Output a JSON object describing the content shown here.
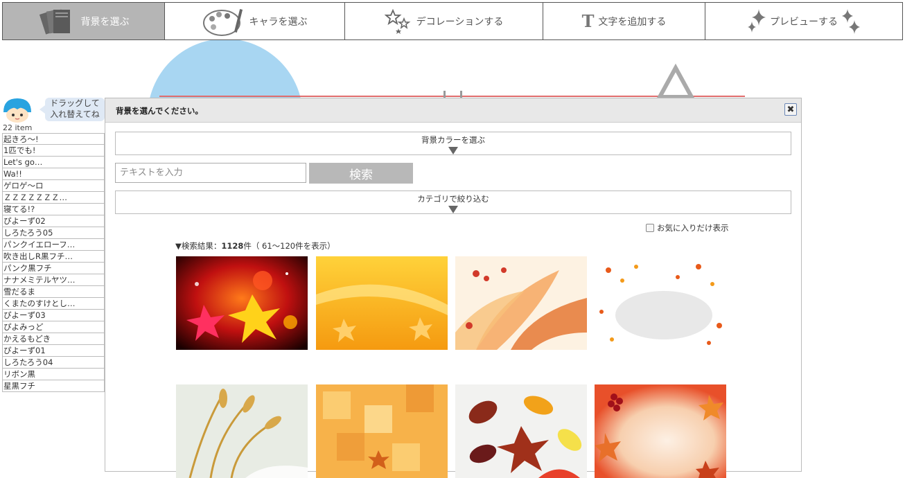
{
  "tabs": [
    {
      "label": "背景を選ぶ",
      "icon": "backgrounds-icon",
      "active": true
    },
    {
      "label": "キャラを選ぶ",
      "icon": "palette-icon",
      "active": false
    },
    {
      "label": "デコレーションする",
      "icon": "stars-icon",
      "active": false
    },
    {
      "label": "文字を追加する",
      "icon": "text-T-icon",
      "active": false
    },
    {
      "label": "プレビューする",
      "icon": "sparkle-icon",
      "active": false
    }
  ],
  "sidebar": {
    "bubble_line1": "ドラッグして",
    "bubble_line2": "入れ替えてね",
    "item_count": "22 item",
    "items": [
      "起きろ〜!",
      "1匹でも!",
      "Let's go…",
      "Wa!!",
      "ゲロゲ〜ロ",
      "ＺＺＺＺＺＺＺ…",
      "寝てる!?",
      "ぴよーず02",
      "しろたろう05",
      "パンクイエローフ…",
      "吹き出しR黒フチ…",
      "パンク黒フチ",
      "ナナメミテルヤツ…",
      "雪だるま",
      "くまたのすけとし…",
      "ぴよーず03",
      "ぴよみっど",
      "かえるもどき",
      "ぴよーず01",
      "しろたろう04",
      "リボン黒",
      "星黒フチ"
    ]
  },
  "dialog": {
    "title": "背景を選んでください。",
    "color_select_label": "背景カラーを選ぶ",
    "search_placeholder": "テキストを入力",
    "search_button": "検索",
    "category_label": "カテゴリで絞り込む",
    "favorites_label": "お気に入りだけ表示",
    "result_prefix": "▼検索結果：",
    "result_count": "1128",
    "result_suffix": "件（ 61〜120件を表示）"
  },
  "colors": {
    "active_tab": "#b5b5b5",
    "search_button": "#b8b8b8",
    "bubble": "#dfe9f5"
  }
}
